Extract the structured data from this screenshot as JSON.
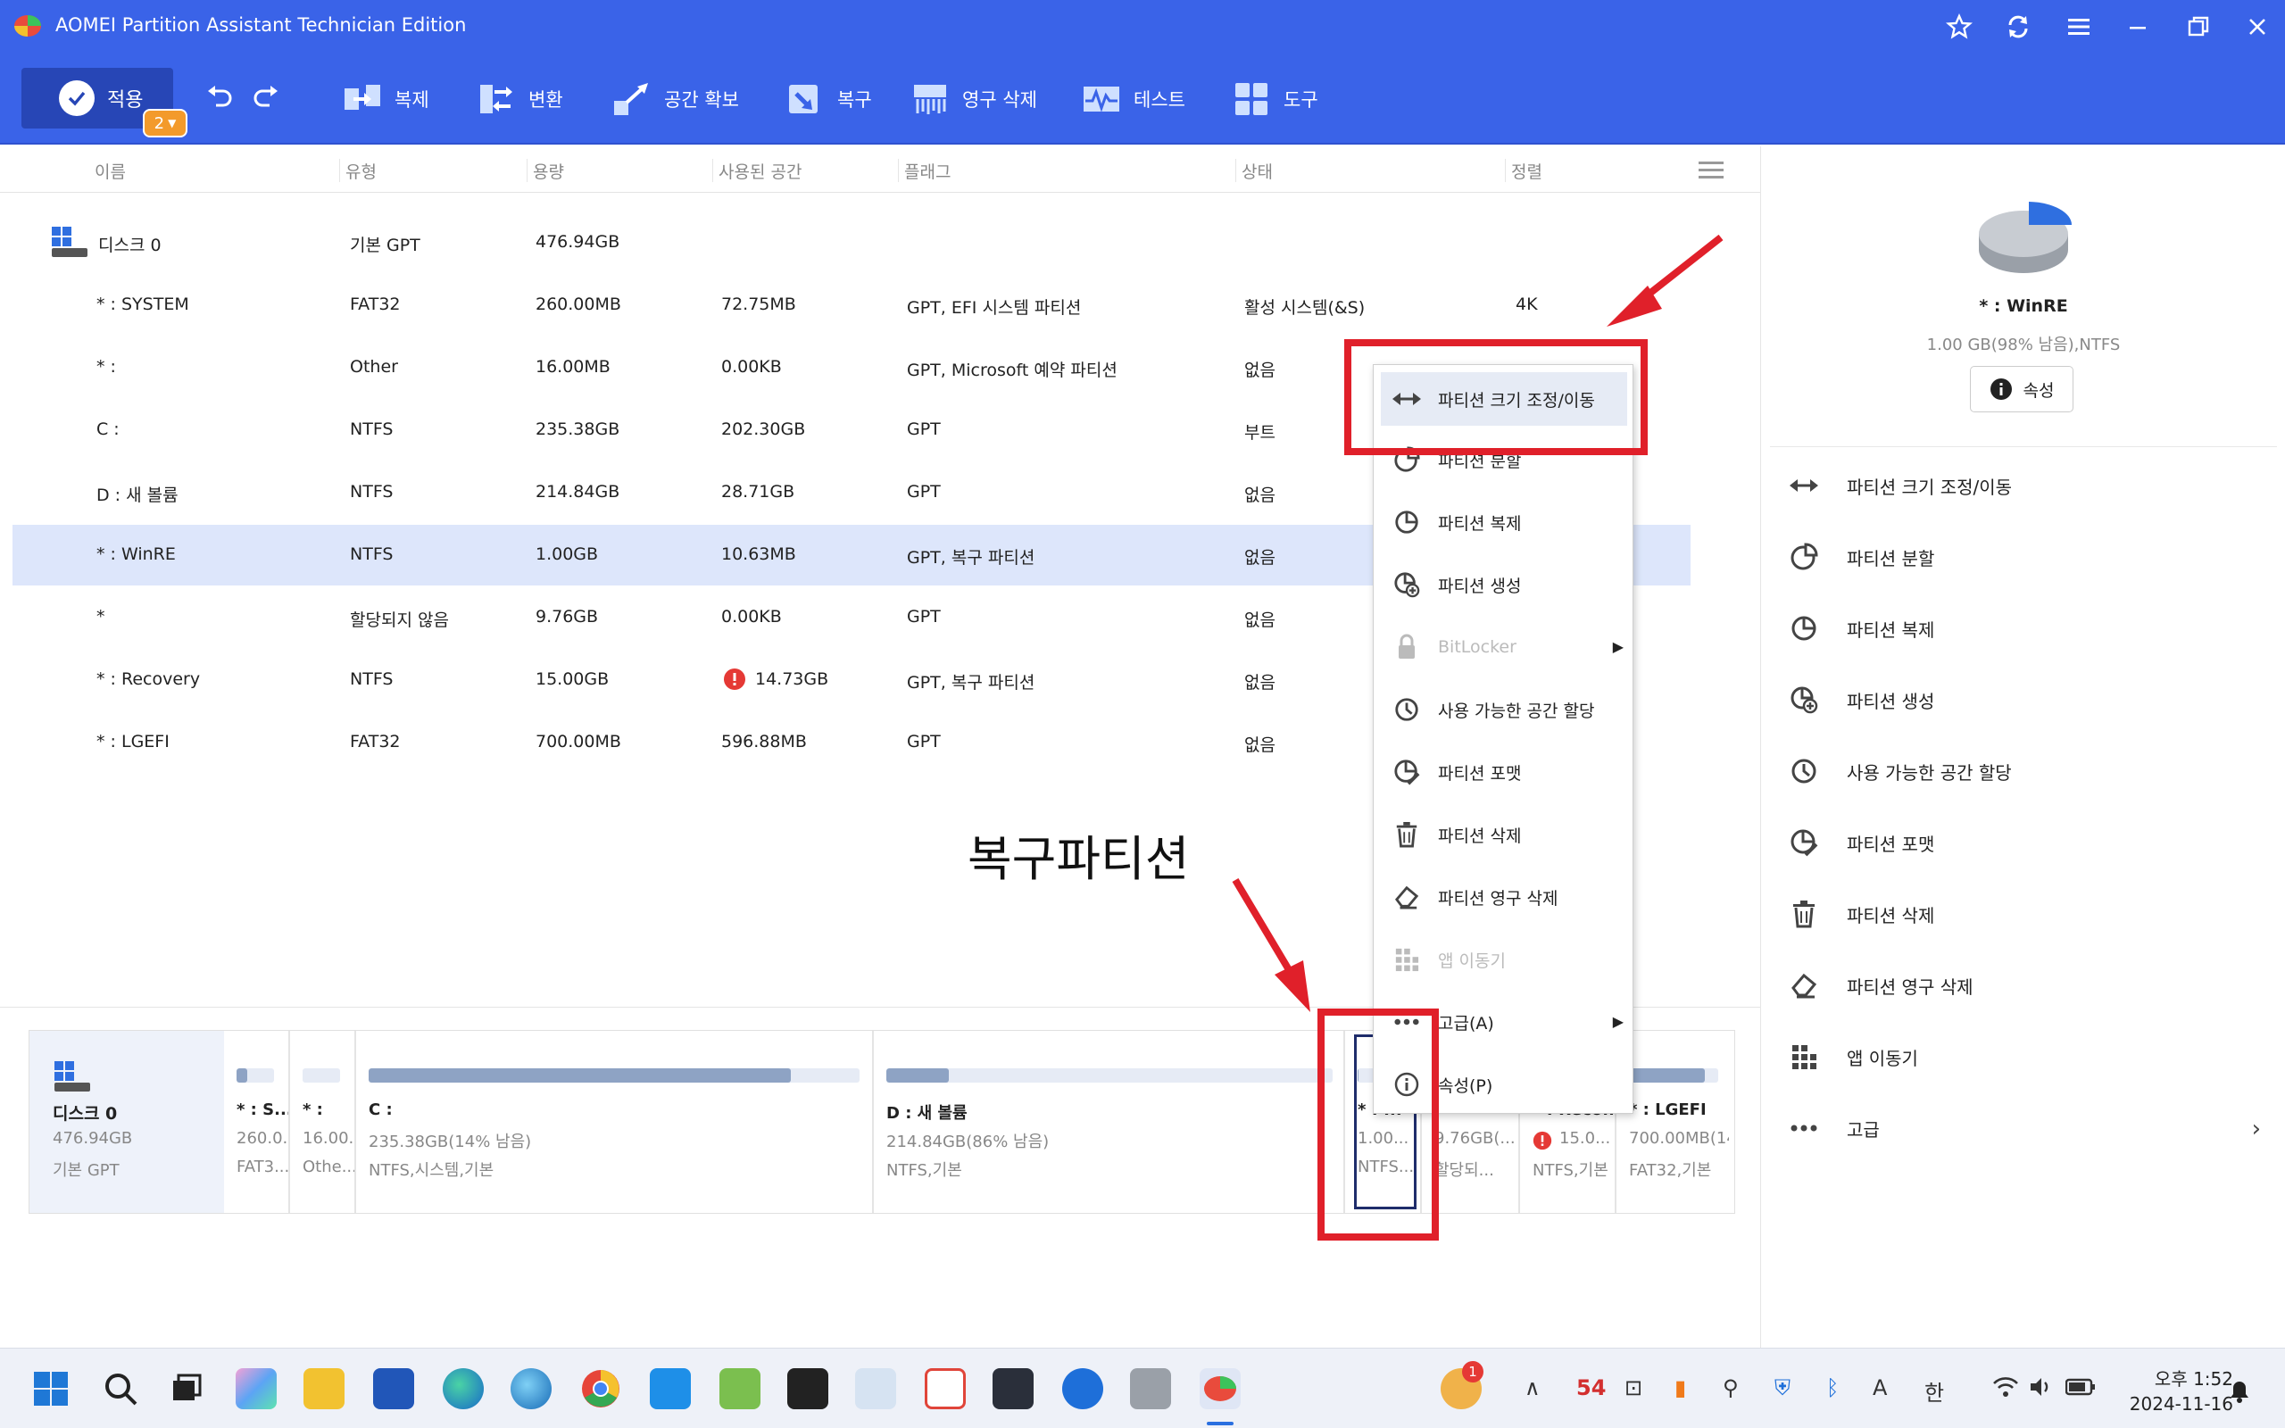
{
  "window": {
    "title": "AOMEI Partition Assistant Technician Edition"
  },
  "toolbar": {
    "apply_label": "적용",
    "apply_badge": "2",
    "items": [
      {
        "label": "복제",
        "icon": "clone-icon"
      },
      {
        "label": "변환",
        "icon": "convert-icon"
      },
      {
        "label": "공간 확보",
        "icon": "free-space-icon"
      },
      {
        "label": "복구",
        "icon": "recover-icon"
      },
      {
        "label": "영구 삭제",
        "icon": "wipe-icon"
      },
      {
        "label": "테스트",
        "icon": "test-icon"
      },
      {
        "label": "도구",
        "icon": "tools-icon"
      }
    ]
  },
  "table": {
    "columns": [
      "이름",
      "유형",
      "용량",
      "사용된 공간",
      "플래그",
      "상태",
      "정렬"
    ],
    "disk": {
      "name": "디스크 0",
      "type": "기본 GPT",
      "capacity": "476.94GB"
    },
    "rows": [
      {
        "name": "* : SYSTEM",
        "type": "FAT32",
        "capacity": "260.00MB",
        "used": "72.75MB",
        "flag": "GPT, EFI 시스템 파티션",
        "status": "활성 시스템(&S)",
        "align": "4K"
      },
      {
        "name": "* :",
        "type": "Other",
        "capacity": "16.00MB",
        "used": "0.00KB",
        "flag": "GPT, Microsoft 예약 파티션",
        "status": "없음",
        "align": ""
      },
      {
        "name": "C :",
        "type": "NTFS",
        "capacity": "235.38GB",
        "used": "202.30GB",
        "flag": "GPT",
        "status": "부트",
        "align": ""
      },
      {
        "name": "D : 새 볼륨",
        "type": "NTFS",
        "capacity": "214.84GB",
        "used": "28.71GB",
        "flag": "GPT",
        "status": "없음",
        "align": ""
      },
      {
        "name": "* : WinRE",
        "type": "NTFS",
        "capacity": "1.00GB",
        "used": "10.63MB",
        "flag": "GPT, 복구 파티션",
        "status": "없음",
        "align": ""
      },
      {
        "name": "*",
        "type": "할당되지 않음",
        "capacity": "9.76GB",
        "used": "0.00KB",
        "flag": "GPT",
        "status": "없음",
        "align": ""
      },
      {
        "name": "* : Recovery",
        "type": "NTFS",
        "capacity": "15.00GB",
        "used": "14.73GB",
        "flag": "GPT, 복구 파티션",
        "status": "없음",
        "align": ""
      },
      {
        "name": "* : LGEFI",
        "type": "FAT32",
        "capacity": "700.00MB",
        "used": "596.88MB",
        "flag": "GPT",
        "status": "없음",
        "align": ""
      }
    ]
  },
  "right_panel": {
    "name": "* : WinRE",
    "info": "1.00 GB(98% 남음),NTFS",
    "properties_label": "속성",
    "items": [
      "파티션 크기 조정/이동",
      "파티션 분할",
      "파티션 복제",
      "파티션 생성",
      "사용 가능한 공간 할당",
      "파티션 포맷",
      "파티션 삭제",
      "파티션 영구 삭제",
      "앱 이동기",
      "고급"
    ]
  },
  "context_menu": {
    "items": [
      {
        "label": "파티션 크기 조정/이동"
      },
      {
        "label": "파티션 분할"
      },
      {
        "label": "파티션 복제"
      },
      {
        "label": "파티션 생성"
      },
      {
        "label": "BitLocker"
      },
      {
        "label": "사용 가능한 공간 할당"
      },
      {
        "label": "파티션 포맷"
      },
      {
        "label": "파티션 삭제"
      },
      {
        "label": "파티션 영구 삭제"
      },
      {
        "label": "앱 이동기"
      },
      {
        "label": "고급(A)"
      },
      {
        "label": "속성(P)"
      }
    ]
  },
  "disk_map": {
    "disk": {
      "name": "디스크 0",
      "size": "476.94GB",
      "type": "기본 GPT"
    },
    "segments": [
      {
        "label": "* : S...",
        "sub1": "260.0...",
        "sub2": "FAT3...",
        "used_fraction": 0.28
      },
      {
        "label": "* :",
        "sub1": "16.00...",
        "sub2": "Othe...",
        "used_fraction": 0.0
      },
      {
        "label": "C :",
        "sub1": "235.38GB(14% 남음)",
        "sub2": "NTFS,시스템,기본",
        "used_fraction": 0.86
      },
      {
        "label": "D : 새 볼륨",
        "sub1": "214.84GB(86% 남음)",
        "sub2": "NTFS,기본",
        "used_fraction": 0.14
      },
      {
        "label": "* : ...",
        "sub1": "1.00...",
        "sub2": "NTFS...",
        "used_fraction": 0.02
      },
      {
        "label": "*",
        "sub1": "9.76GB(...",
        "sub2": "할당되...",
        "used_fraction": 0.0
      },
      {
        "label": "* : Reco...",
        "sub1": "15.0...",
        "sub2": "NTFS,기본",
        "used_fraction": 0.98
      },
      {
        "label": "* : LGEFI",
        "sub1": "700.00MB(14...",
        "sub2": "FAT32,기본",
        "used_fraction": 0.85
      }
    ]
  },
  "annotation": {
    "text": "복구파티션"
  },
  "taskbar": {
    "tray_temp": "54",
    "tray_lang_a": "A",
    "tray_lang_ko": "한",
    "notify_badge": "1",
    "time": "오후 1:52",
    "date": "2024-11-16"
  },
  "colors": {
    "accent": "#3a63e8",
    "toolbar_dark": "#2746b6",
    "selection": "#dde6fb",
    "annotation_red": "#e0202a",
    "badge_orange": "#f39a2b"
  }
}
